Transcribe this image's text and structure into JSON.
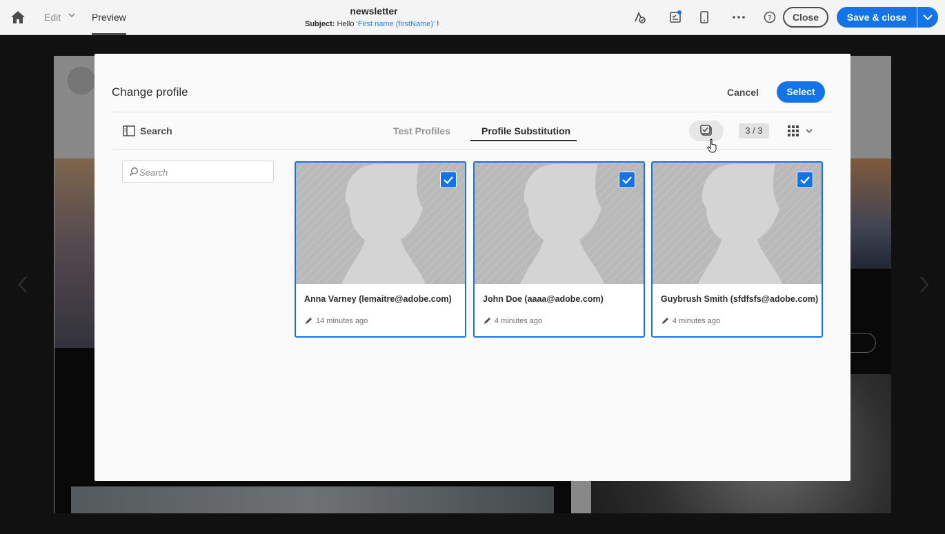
{
  "topbar": {
    "edit_label": "Edit",
    "preview_label": "Preview",
    "title": "newsletter",
    "subject_label": "Subject:",
    "subject_text": "Hello ",
    "subject_token": "'First name (firstName)'",
    "subject_suffix": " !",
    "close_label": "Close",
    "save_close_label": "Save & close"
  },
  "modal": {
    "title": "Change profile",
    "cancel_label": "Cancel",
    "select_label": "Select",
    "search_rail_label": "Search",
    "tabs": [
      {
        "label": "Test Profiles",
        "active": false
      },
      {
        "label": "Profile Substitution",
        "active": true
      }
    ],
    "selection_count": "3 / 3",
    "search_placeholder": "Search"
  },
  "profiles": [
    {
      "name": "Anna Varney (lemaitre@adobe.com)",
      "modified": "14 minutes ago",
      "selected": true
    },
    {
      "name": "John Doe (aaaa@adobe.com)",
      "modified": "4 minutes ago",
      "selected": true
    },
    {
      "name": "Guybrush Smith (sfdfsfs@adobe.com)",
      "modified": "4 minutes ago",
      "selected": true
    }
  ],
  "colors": {
    "accent": "#1473e6",
    "token": "#2680eb"
  }
}
